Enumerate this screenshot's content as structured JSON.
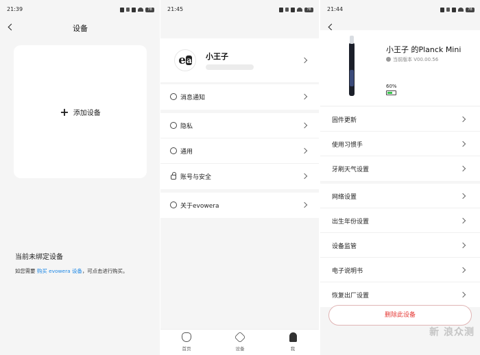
{
  "screen1": {
    "time": "21:39",
    "title": "设备",
    "add_device_label": "添加设备",
    "unbound_title": "当前未绑定设备",
    "hint_prefix": "如您需要",
    "hint_link": "购买 evowera 设备",
    "hint_suffix": "，可点击进行购买。"
  },
  "screen2": {
    "time": "21:45",
    "avatar_text": "e",
    "avatar_text_2": "a",
    "profile_name": "小王子",
    "menu": [
      {
        "label": "消息通知",
        "icon": "message-icon"
      },
      {
        "label": "隐私",
        "icon": "eye-icon"
      },
      {
        "label": "通用",
        "icon": "general-icon"
      },
      {
        "label": "账号与安全",
        "icon": "lock-icon"
      },
      {
        "label": "关于evowera",
        "icon": "info-icon"
      }
    ],
    "tabs": [
      {
        "label": "首页",
        "icon": "tooth-icon"
      },
      {
        "label": "设备",
        "icon": "device-hex-icon"
      },
      {
        "label": "我",
        "icon": "person-icon"
      }
    ]
  },
  "screen3": {
    "time": "21:44",
    "device_name": "小王子 的Planck Mini",
    "version_text": "当前版本 V00.00.56",
    "battery_text": "60%",
    "battery_level": 0.6,
    "menu_group1": [
      "固件更新",
      "使用习惯手",
      "牙刷天气设置"
    ],
    "menu_group2": [
      "网络设置",
      "出生年份设置",
      "设备监管",
      "电子说明书",
      "恢复出厂设置"
    ],
    "delete_label": "删除此设备"
  },
  "battery_status": "78",
  "watermark": "新 浪众测",
  "colors": {
    "link": "#1e88e5",
    "danger": "#e53935",
    "battery_fill": "#36c24b"
  }
}
